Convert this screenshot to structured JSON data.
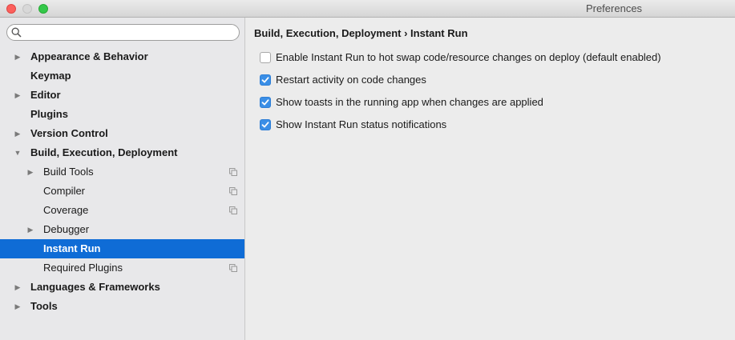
{
  "window": {
    "title": "Preferences"
  },
  "search": {
    "placeholder": "",
    "value": ""
  },
  "sidebar": {
    "items": [
      {
        "label": "Appearance & Behavior",
        "level": 0,
        "expandable": true,
        "expanded": false,
        "selected": false,
        "copy_icon": false
      },
      {
        "label": "Keymap",
        "level": 0,
        "expandable": false,
        "expanded": false,
        "selected": false,
        "copy_icon": false
      },
      {
        "label": "Editor",
        "level": 0,
        "expandable": true,
        "expanded": false,
        "selected": false,
        "copy_icon": false
      },
      {
        "label": "Plugins",
        "level": 0,
        "expandable": false,
        "expanded": false,
        "selected": false,
        "copy_icon": false
      },
      {
        "label": "Version Control",
        "level": 0,
        "expandable": true,
        "expanded": false,
        "selected": false,
        "copy_icon": false
      },
      {
        "label": "Build, Execution, Deployment",
        "level": 0,
        "expandable": true,
        "expanded": true,
        "selected": false,
        "copy_icon": false
      },
      {
        "label": "Build Tools",
        "level": 1,
        "expandable": true,
        "expanded": false,
        "selected": false,
        "copy_icon": true
      },
      {
        "label": "Compiler",
        "level": 1,
        "expandable": false,
        "expanded": false,
        "selected": false,
        "copy_icon": true
      },
      {
        "label": "Coverage",
        "level": 1,
        "expandable": false,
        "expanded": false,
        "selected": false,
        "copy_icon": true
      },
      {
        "label": "Debugger",
        "level": 1,
        "expandable": true,
        "expanded": false,
        "selected": false,
        "copy_icon": false
      },
      {
        "label": "Instant Run",
        "level": 1,
        "expandable": false,
        "expanded": false,
        "selected": true,
        "copy_icon": false
      },
      {
        "label": "Required Plugins",
        "level": 1,
        "expandable": false,
        "expanded": false,
        "selected": false,
        "copy_icon": true
      },
      {
        "label": "Languages & Frameworks",
        "level": 0,
        "expandable": true,
        "expanded": false,
        "selected": false,
        "copy_icon": false
      },
      {
        "label": "Tools",
        "level": 0,
        "expandable": true,
        "expanded": false,
        "selected": false,
        "copy_icon": false
      }
    ]
  },
  "content": {
    "breadcrumb": "Build, Execution, Deployment › Instant Run",
    "options": [
      {
        "label": "Enable Instant Run to hot swap code/resource changes on deploy (default enabled)",
        "checked": false
      },
      {
        "label": "Restart activity on code changes",
        "checked": true
      },
      {
        "label": "Show toasts in the running app when changes are applied",
        "checked": true
      },
      {
        "label": "Show Instant Run status notifications",
        "checked": true
      }
    ]
  },
  "colors": {
    "selection": "#0f6cd6",
    "checkbox_checked": "#3a8ee6"
  }
}
